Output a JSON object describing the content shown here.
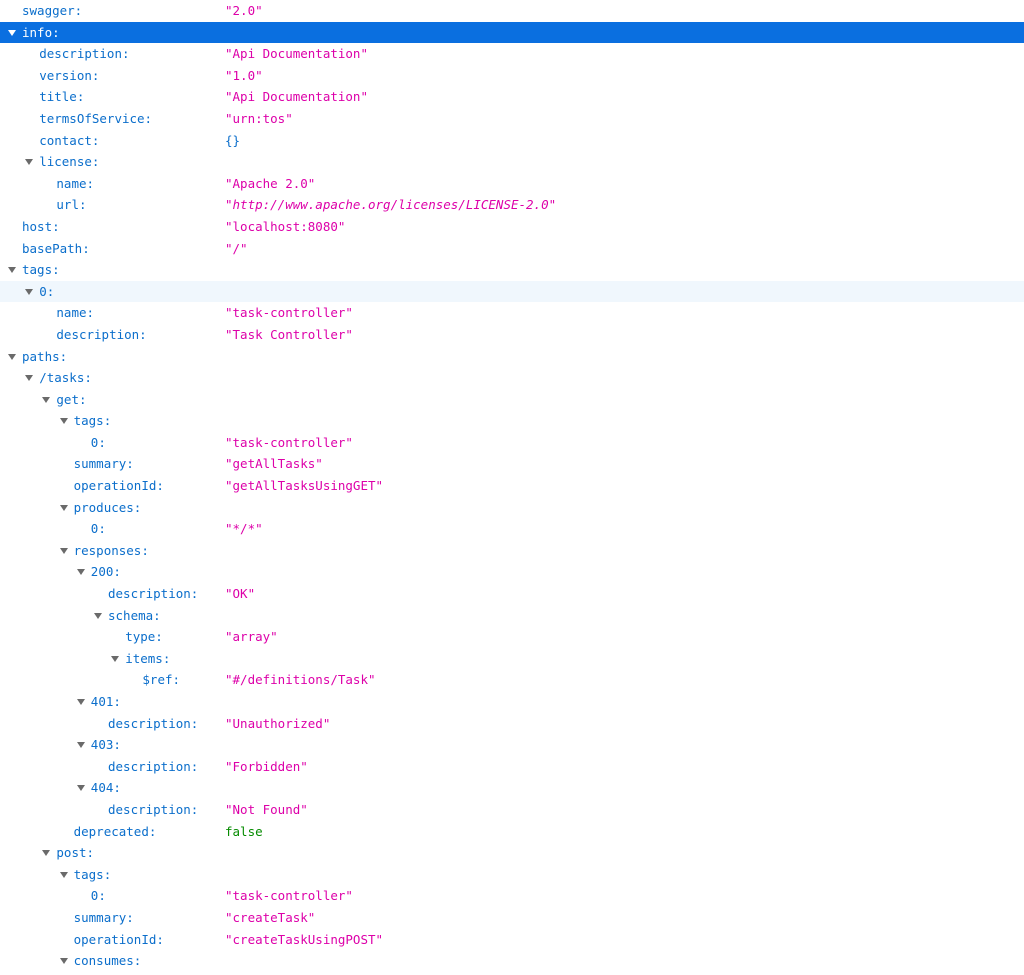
{
  "colors": {
    "key": "#0b6ecb",
    "string": "#dd00a9",
    "boolean": "#058b00",
    "selected_bg": "#0a6fe0",
    "hover_bg": "#f0f7fd",
    "twisty": "#6a6a6a"
  },
  "rows": [
    {
      "key": "swagger:",
      "value": "\"2.0\"",
      "depth": 0,
      "toggle": false,
      "type": "string"
    },
    {
      "key": "info:",
      "value": "",
      "depth": 0,
      "toggle": true,
      "type": "",
      "selected": true
    },
    {
      "key": "description:",
      "value": "\"Api Documentation\"",
      "depth": 1,
      "toggle": false,
      "type": "string"
    },
    {
      "key": "version:",
      "value": "\"1.0\"",
      "depth": 1,
      "toggle": false,
      "type": "string"
    },
    {
      "key": "title:",
      "value": "\"Api Documentation\"",
      "depth": 1,
      "toggle": false,
      "type": "string"
    },
    {
      "key": "termsOfService:",
      "value": "\"urn:tos\"",
      "depth": 1,
      "toggle": false,
      "type": "string"
    },
    {
      "key": "contact:",
      "value": "{}",
      "depth": 1,
      "toggle": false,
      "type": "object"
    },
    {
      "key": "license:",
      "value": "",
      "depth": 1,
      "toggle": true,
      "type": ""
    },
    {
      "key": "name:",
      "value": "\"Apache 2.0\"",
      "depth": 2,
      "toggle": false,
      "type": "string"
    },
    {
      "key": "url:",
      "value": "\"http://www.apache.org/licenses/LICENSE-2.0\"",
      "depth": 2,
      "toggle": false,
      "type": "url"
    },
    {
      "key": "host:",
      "value": "\"localhost:8080\"",
      "depth": 0,
      "toggle": false,
      "type": "string"
    },
    {
      "key": "basePath:",
      "value": "\"/\"",
      "depth": 0,
      "toggle": false,
      "type": "string"
    },
    {
      "key": "tags:",
      "value": "",
      "depth": 0,
      "toggle": true,
      "type": ""
    },
    {
      "key": "0:",
      "value": "",
      "depth": 1,
      "toggle": true,
      "type": "",
      "hover": true
    },
    {
      "key": "name:",
      "value": "\"task-controller\"",
      "depth": 2,
      "toggle": false,
      "type": "string"
    },
    {
      "key": "description:",
      "value": "\"Task Controller\"",
      "depth": 2,
      "toggle": false,
      "type": "string"
    },
    {
      "key": "paths:",
      "value": "",
      "depth": 0,
      "toggle": true,
      "type": ""
    },
    {
      "key": "/tasks:",
      "value": "",
      "depth": 1,
      "toggle": true,
      "type": ""
    },
    {
      "key": "get:",
      "value": "",
      "depth": 2,
      "toggle": true,
      "type": ""
    },
    {
      "key": "tags:",
      "value": "",
      "depth": 3,
      "toggle": true,
      "type": ""
    },
    {
      "key": "0:",
      "value": "\"task-controller\"",
      "depth": 4,
      "toggle": false,
      "type": "string"
    },
    {
      "key": "summary:",
      "value": "\"getAllTasks\"",
      "depth": 3,
      "toggle": false,
      "type": "string"
    },
    {
      "key": "operationId:",
      "value": "\"getAllTasksUsingGET\"",
      "depth": 3,
      "toggle": false,
      "type": "string"
    },
    {
      "key": "produces:",
      "value": "",
      "depth": 3,
      "toggle": true,
      "type": ""
    },
    {
      "key": "0:",
      "value": "\"*/*\"",
      "depth": 4,
      "toggle": false,
      "type": "string"
    },
    {
      "key": "responses:",
      "value": "",
      "depth": 3,
      "toggle": true,
      "type": ""
    },
    {
      "key": "200:",
      "value": "",
      "depth": 4,
      "toggle": true,
      "type": ""
    },
    {
      "key": "description:",
      "value": "\"OK\"",
      "depth": 5,
      "toggle": false,
      "type": "string"
    },
    {
      "key": "schema:",
      "value": "",
      "depth": 5,
      "toggle": true,
      "type": ""
    },
    {
      "key": "type:",
      "value": "\"array\"",
      "depth": 6,
      "toggle": false,
      "type": "string"
    },
    {
      "key": "items:",
      "value": "",
      "depth": 6,
      "toggle": true,
      "type": ""
    },
    {
      "key": "$ref:",
      "value": "\"#/definitions/Task\"",
      "depth": 7,
      "toggle": false,
      "type": "string"
    },
    {
      "key": "401:",
      "value": "",
      "depth": 4,
      "toggle": true,
      "type": ""
    },
    {
      "key": "description:",
      "value": "\"Unauthorized\"",
      "depth": 5,
      "toggle": false,
      "type": "string"
    },
    {
      "key": "403:",
      "value": "",
      "depth": 4,
      "toggle": true,
      "type": ""
    },
    {
      "key": "description:",
      "value": "\"Forbidden\"",
      "depth": 5,
      "toggle": false,
      "type": "string"
    },
    {
      "key": "404:",
      "value": "",
      "depth": 4,
      "toggle": true,
      "type": ""
    },
    {
      "key": "description:",
      "value": "\"Not Found\"",
      "depth": 5,
      "toggle": false,
      "type": "string"
    },
    {
      "key": "deprecated:",
      "value": "false",
      "depth": 3,
      "toggle": false,
      "type": "bool"
    },
    {
      "key": "post:",
      "value": "",
      "depth": 2,
      "toggle": true,
      "type": ""
    },
    {
      "key": "tags:",
      "value": "",
      "depth": 3,
      "toggle": true,
      "type": ""
    },
    {
      "key": "0:",
      "value": "\"task-controller\"",
      "depth": 4,
      "toggle": false,
      "type": "string"
    },
    {
      "key": "summary:",
      "value": "\"createTask\"",
      "depth": 3,
      "toggle": false,
      "type": "string"
    },
    {
      "key": "operationId:",
      "value": "\"createTaskUsingPOST\"",
      "depth": 3,
      "toggle": false,
      "type": "string"
    },
    {
      "key": "consumes:",
      "value": "",
      "depth": 3,
      "toggle": true,
      "type": ""
    }
  ]
}
